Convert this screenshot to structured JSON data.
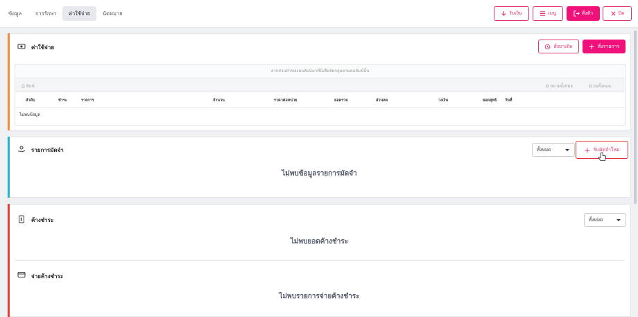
{
  "tabs": [
    {
      "label": "ข้อมูล",
      "active": false
    },
    {
      "label": "การรักษา",
      "active": false
    },
    {
      "label": "ค่าใช้จ่าย",
      "active": true
    },
    {
      "label": "นัดหมาย",
      "active": false
    }
  ],
  "toolbar": {
    "receive_label": "รับเงิน",
    "menu_label": "เมนู",
    "order_label": "สั่งตัว",
    "close_label": "ปิด"
  },
  "expenses": {
    "title": "ค่าใช้จ่าย",
    "add_drug_label": "สั่งยาเดิม",
    "order_items_label": "สั่งรายการ",
    "drop_hint": "ลากส่วนหัวของคอลัมน์มาที่นี่เพื่อจัดกลุ่มตามคอลัมน์นั้น",
    "print_label": "พิมพ์",
    "expand_all_label": "ขยายทั้งหมด",
    "collapse_all_label": "ย่อทั้งหมด",
    "columns": [
      "ลำดับ",
      "ชำระ",
      "รายการ",
      "จำนวน",
      "ราคาต่อหน่วย",
      "ยอดรวม",
      "ส่วนลด",
      "วงเงิน",
      "ยอดสุทธิ",
      "วันที่"
    ],
    "empty_row": "ไม่พบข้อมูล"
  },
  "deposit": {
    "title": "รายการมัดจำ",
    "filter_value": "ทั้งหมด",
    "new_button_label": "รับมัดจำใหม่",
    "empty_message": "ไม่พบข้อมูลรายการมัดจำ"
  },
  "outstanding": {
    "title": "ค้างชำระ",
    "filter_value": "ทั้งหมด",
    "empty_message": "ไม่พบยอดค้างชำระ",
    "pay_title": "จ่ายค้างชำระ",
    "pay_empty_message": "ไม่พบรายการจ่ายค้างชำระ"
  },
  "colors": {
    "accent": "#f0127a",
    "expenses_bar": "#f08a3c",
    "deposit_bar": "#24b3c9",
    "outstanding_bar": "#e0413b"
  }
}
